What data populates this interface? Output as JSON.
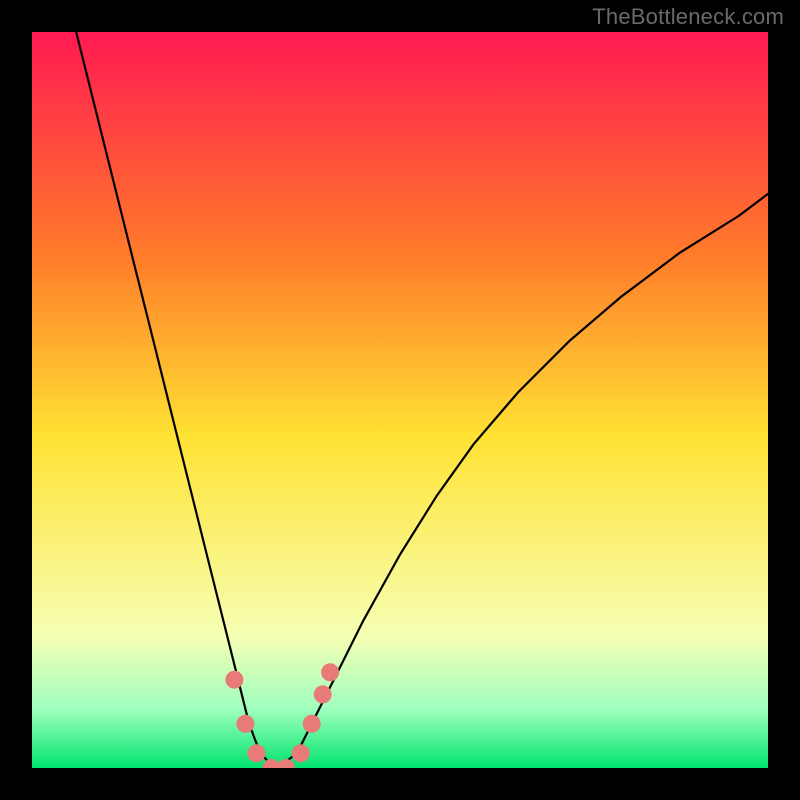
{
  "watermark": "TheBottleneck.com",
  "chart_data": {
    "type": "line",
    "title": "",
    "xlabel": "",
    "ylabel": "",
    "xlim": [
      0,
      100
    ],
    "ylim": [
      0,
      100
    ],
    "grid": false,
    "background_gradient": {
      "top": "#ff1a52",
      "upper_mid": "#ff7a2a",
      "mid": "#ffe233",
      "lower_mid": "#f6ffb3",
      "bottom_band_top": "#9fffbe",
      "bottom": "#00e46e"
    },
    "series": [
      {
        "name": "bottleneck-curve",
        "x": [
          6,
          8,
          10,
          12,
          14,
          16,
          18,
          20,
          22,
          24,
          26,
          28,
          29.5,
          31,
          32.5,
          34,
          36,
          38,
          41,
          45,
          50,
          55,
          60,
          66,
          73,
          80,
          88,
          96,
          100
        ],
        "y": [
          100,
          92,
          84,
          76,
          68,
          60,
          52,
          44,
          36,
          28,
          20,
          12,
          6,
          2,
          0.5,
          0.5,
          2,
          6,
          12,
          20,
          29,
          37,
          44,
          51,
          58,
          64,
          70,
          75,
          78
        ]
      }
    ],
    "markers": {
      "name": "marker-dots",
      "color": "#e87a78",
      "points": [
        {
          "x": 27.5,
          "y": 12
        },
        {
          "x": 29.0,
          "y": 6
        },
        {
          "x": 30.5,
          "y": 2
        },
        {
          "x": 32.5,
          "y": 0
        },
        {
          "x": 34.5,
          "y": 0
        },
        {
          "x": 36.5,
          "y": 2
        },
        {
          "x": 38.0,
          "y": 6
        },
        {
          "x": 39.5,
          "y": 10
        },
        {
          "x": 40.5,
          "y": 13
        }
      ]
    }
  }
}
